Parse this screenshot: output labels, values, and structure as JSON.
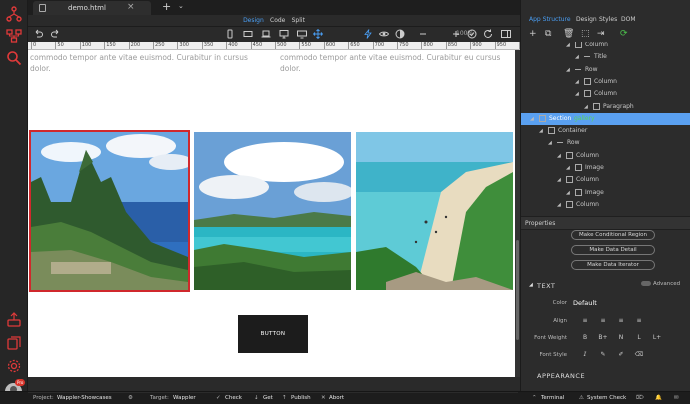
{
  "tab": {
    "title": "demo.html",
    "close": "×",
    "add": "+",
    "more": "⌄"
  },
  "views": [
    "Design",
    "Code",
    "Split"
  ],
  "toolbar": {
    "zoom_label": "100%"
  },
  "ruler": [
    "0",
    "50",
    "100",
    "150",
    "200",
    "250",
    "300",
    "350",
    "400",
    "450",
    "500",
    "550",
    "600",
    "650",
    "700",
    "750",
    "800",
    "850",
    "900",
    "950",
    "1000"
  ],
  "canvas": {
    "para_left": "commodo tempor ante vitae euismod. Curabitur in cursus dolor.",
    "para_right": "commodo tempor ante vitae euismod. Curabitur eu cursus dolor.",
    "button_label": "BUTTON"
  },
  "right_tabs": [
    "App Structure",
    "Design",
    "Styles",
    "DOM"
  ],
  "tree": [
    {
      "label": "Column",
      "depth": 5
    },
    {
      "label": "Title",
      "depth": 6
    },
    {
      "label": "Row",
      "depth": 5
    },
    {
      "label": "Column",
      "depth": 6
    },
    {
      "label": "Column",
      "depth": 6
    },
    {
      "label": "Paragraph",
      "depth": 7
    },
    {
      "label": "Section",
      "suffix": "gallery",
      "depth": 1,
      "selected": true
    },
    {
      "label": "Container",
      "depth": 2
    },
    {
      "label": "Row",
      "depth": 3
    },
    {
      "label": "Column",
      "depth": 4
    },
    {
      "label": "Image",
      "depth": 5
    },
    {
      "label": "Column",
      "depth": 4
    },
    {
      "label": "Image",
      "depth": 5
    },
    {
      "label": "Column",
      "depth": 4
    }
  ],
  "properties": {
    "header": "Properties",
    "buttons": [
      "Make Conditional Region",
      "Make Data Detail",
      "Make Data Iterator"
    ],
    "text_section": "TEXT",
    "advanced": "Advanced",
    "color_label": "Color",
    "color_value": "Default",
    "align_label": "Align",
    "font_weight_label": "Font Weight",
    "font_weight_opts": [
      "B",
      "B+",
      "N",
      "L",
      "L+"
    ],
    "font_style_label": "Font Style",
    "appearance_section": "APPEARANCE"
  },
  "status": {
    "project_label": "Project:",
    "project_value": "Wappler-Showcases",
    "target_label": "Target:",
    "target_value": "Wappler",
    "check": "Check",
    "get": "Get",
    "publish": "Publish",
    "abort": "Abort",
    "terminal": "Terminal",
    "system_check": "System Check"
  },
  "avatar_badge": "Pro",
  "colors": {
    "accent": "#4a9ff5",
    "selection": "#d0282c",
    "logo": "#e03a3a"
  }
}
